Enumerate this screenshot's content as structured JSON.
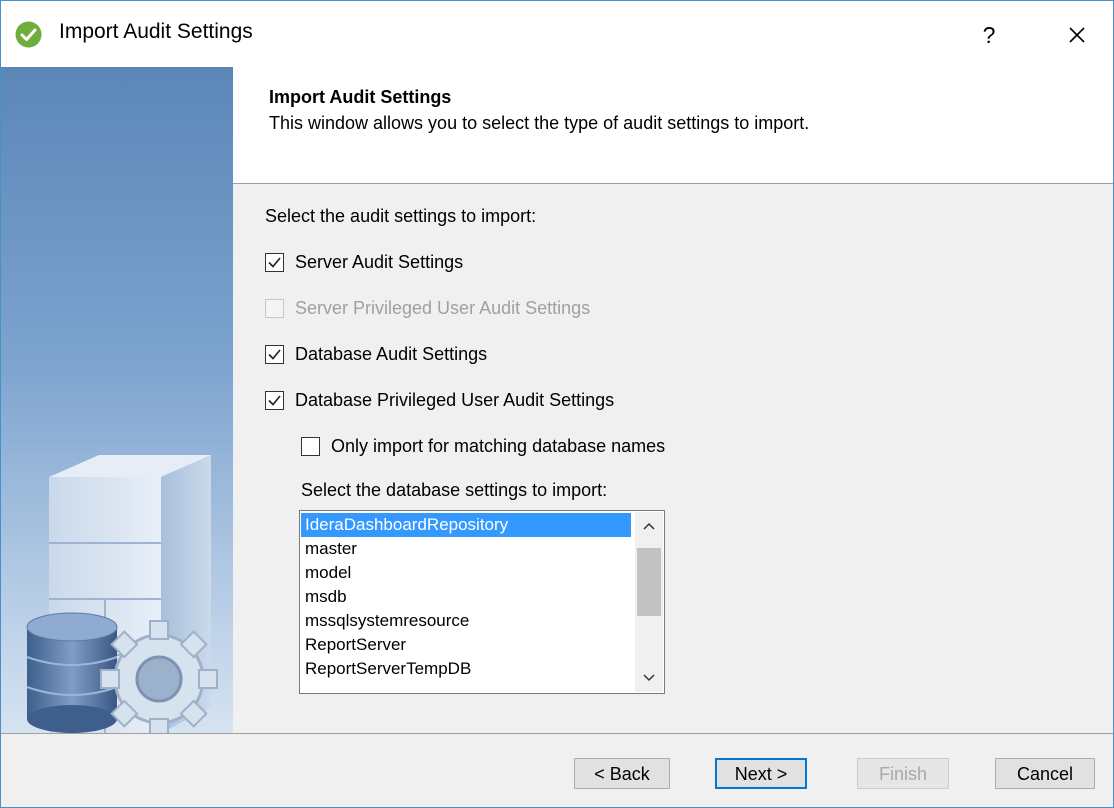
{
  "window": {
    "title": "Import Audit Settings",
    "help_label": "?"
  },
  "header": {
    "title": "Import Audit Settings",
    "description": "This window allows you to select the type of audit settings to import."
  },
  "content": {
    "prompt": "Select the audit settings to import:",
    "checkboxes": [
      {
        "label": "Server Audit Settings",
        "checked": true,
        "enabled": true
      },
      {
        "label": "Server Privileged User Audit Settings",
        "checked": false,
        "enabled": false
      },
      {
        "label": "Database Audit Settings",
        "checked": true,
        "enabled": true
      },
      {
        "label": "Database Privileged User Audit Settings",
        "checked": true,
        "enabled": true
      }
    ],
    "matching_option": {
      "label": "Only import for matching database names",
      "checked": false
    },
    "db_prompt": "Select the database settings to import:",
    "databases": [
      "IderaDashboardRepository",
      "master",
      "model",
      "msdb",
      "mssqlsystemresource",
      "ReportServer",
      "ReportServerTempDB"
    ],
    "selected_database": "IderaDashboardRepository"
  },
  "buttons": {
    "back": "< Back",
    "next": "Next >",
    "finish": "Finish",
    "cancel": "Cancel"
  },
  "colors": {
    "selection": "#3399ff",
    "default_button_border": "#0078d7",
    "title_icon": "#6fae3c"
  }
}
